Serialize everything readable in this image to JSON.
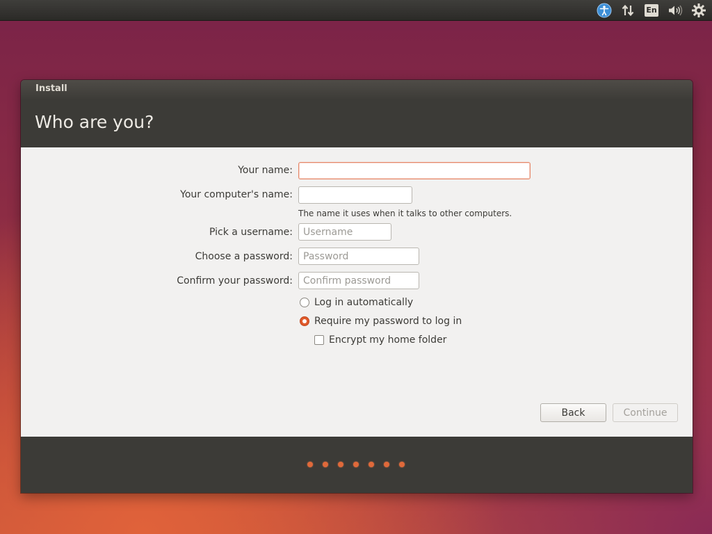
{
  "top_panel": {
    "indicators": [
      {
        "icon": "accessibility-icon"
      },
      {
        "icon": "network-transfer-icon"
      },
      {
        "icon": "keyboard-layout-icon",
        "label": "En"
      },
      {
        "icon": "volume-icon"
      },
      {
        "icon": "system-settings-icon"
      }
    ]
  },
  "window": {
    "title": "Install",
    "page_title": "Who are you?"
  },
  "form": {
    "your_name": {
      "label": "Your name:",
      "value": "",
      "placeholder": ""
    },
    "computer_name": {
      "label": "Your computer's name:",
      "value": "",
      "placeholder": "",
      "hint": "The name it uses when it talks to other computers."
    },
    "username": {
      "label": "Pick a username:",
      "value": "",
      "placeholder": "Username"
    },
    "password": {
      "label": "Choose a password:",
      "value": "",
      "placeholder": "Password"
    },
    "confirm_password": {
      "label": "Confirm your password:",
      "value": "",
      "placeholder": "Confirm password"
    },
    "login_options": [
      {
        "label": "Log in automatically",
        "checked": false
      },
      {
        "label": "Require my password to log in",
        "checked": true
      }
    ],
    "encrypt_home": {
      "label": "Encrypt my home folder",
      "checked": false
    }
  },
  "buttons": {
    "back": "Back",
    "continue": "Continue"
  },
  "progress": {
    "step_count": 7,
    "accent_color": "#e0693a"
  },
  "colors": {
    "accent": "#e05a2b",
    "title_bar": "#3c3b37",
    "content_bg": "#f2f1f0"
  }
}
